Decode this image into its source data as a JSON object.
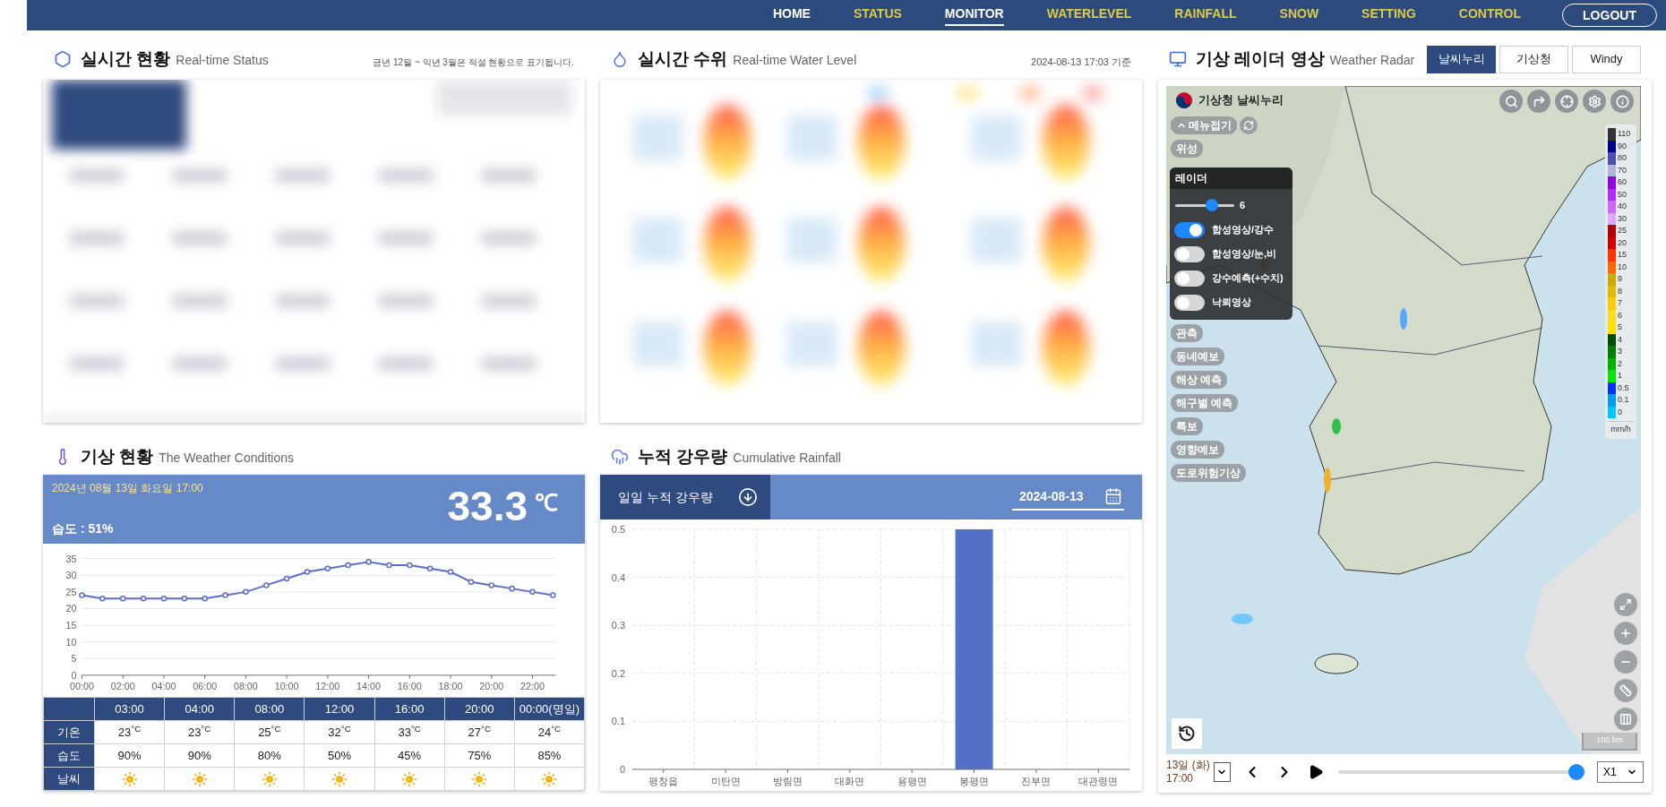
{
  "nav": {
    "items": [
      {
        "label": "HOME",
        "color": "#ffffff",
        "selected": false
      },
      {
        "label": "STATUS",
        "color": "#dccb4c",
        "selected": false
      },
      {
        "label": "MONITOR",
        "color": "#ffffff",
        "selected": true
      },
      {
        "label": "WATERLEVEL",
        "color": "#dccb4c",
        "selected": false
      },
      {
        "label": "RAINFALL",
        "color": "#dccb4c",
        "selected": false
      },
      {
        "label": "SNOW",
        "color": "#dccb4c",
        "selected": false
      },
      {
        "label": "SETTING",
        "color": "#dccb4c",
        "selected": false
      },
      {
        "label": "CONTROL",
        "color": "#dccb4c",
        "selected": false
      }
    ],
    "logout": "LOGOUT"
  },
  "status_panel": {
    "title": "실시간 현황",
    "subtitle": "Real-time Status",
    "note": "금년 12월 ~ 익년 3월은 적설 현황으로 표기됩니다."
  },
  "water_panel": {
    "title": "실시간 수위",
    "subtitle": "Real-time Water Level",
    "timestamp": "2024-08-13 17:03 기준"
  },
  "radar_panel": {
    "title": "기상 레이더 영상",
    "subtitle": "Weather Radar",
    "tabs": [
      {
        "label": "날씨누리",
        "selected": true
      },
      {
        "label": "기상청",
        "selected": false
      },
      {
        "label": "Windy",
        "selected": false
      }
    ],
    "map": {
      "logo": "기상청 날씨누리",
      "collapse_button": "메뉴접기",
      "menu_top": [
        "위성"
      ],
      "layer_panel": {
        "title": "레이더",
        "opacity": {
          "level": 0.65,
          "reading": "6"
        },
        "layers": [
          {
            "label": "합성영상/강수",
            "on": true
          },
          {
            "label": "합성영상/눈,비",
            "on": false
          },
          {
            "label": "강수예측(+수치)",
            "on": false
          },
          {
            "label": "낙뢰영상",
            "on": false
          }
        ]
      },
      "menu_bottom": [
        "관측",
        "동네예보",
        "해상 예측",
        "해구별 예측",
        "특보",
        "영향예보",
        "도로위험기상"
      ],
      "legend": {
        "items": [
          {
            "label": "110",
            "color": "#333333"
          },
          {
            "label": "90",
            "color": "#000090"
          },
          {
            "label": "80",
            "color": "#4c4eb1"
          },
          {
            "label": "70",
            "color": "#b3b4de"
          },
          {
            "label": "60",
            "color": "#9300e4"
          },
          {
            "label": "50",
            "color": "#b329ff"
          },
          {
            "label": "40",
            "color": "#c969ff"
          },
          {
            "label": "30",
            "color": "#e0a9ff"
          },
          {
            "label": "25",
            "color": "#b40000"
          },
          {
            "label": "20",
            "color": "#d20000"
          },
          {
            "label": "15",
            "color": "#ff3200"
          },
          {
            "label": "10",
            "color": "#ff6600"
          },
          {
            "label": "9",
            "color": "#ccaa00"
          },
          {
            "label": "8",
            "color": "#e0b900"
          },
          {
            "label": "7",
            "color": "#f9cd00"
          },
          {
            "label": "6",
            "color": "#ffdc1f"
          },
          {
            "label": "5",
            "color": "#ffe100"
          },
          {
            "label": "4",
            "color": "#004d00"
          },
          {
            "label": "3",
            "color": "#008000"
          },
          {
            "label": "2",
            "color": "#00b300"
          },
          {
            "label": "1",
            "color": "#00e600"
          },
          {
            "label": "0.5",
            "color": "#0033ff"
          },
          {
            "label": "0.1",
            "color": "#009bf5"
          },
          {
            "label": "0",
            "color": "#00c8ff"
          }
        ],
        "unit": "mm/h"
      },
      "scale": "100 km"
    },
    "playback": {
      "day": "13일 (화)",
      "time": "17:00",
      "progress": {
        "level": 1
      },
      "speed": "X1"
    }
  },
  "weather_panel": {
    "title": "기상 현황",
    "subtitle": "The Weather Conditions",
    "datetime": "2024년 08월 13일 화요일 17:00",
    "humidity": "습도 : 51%",
    "temperature": "33.3",
    "unit": "℃",
    "chart_data": {
      "type": "line",
      "x": [
        0,
        1,
        2,
        3,
        4,
        5,
        6,
        7,
        8,
        9,
        10,
        11,
        12,
        13,
        14,
        15,
        16,
        17,
        18,
        19,
        20,
        21,
        22,
        23
      ],
      "grid": true,
      "series": [
        {
          "color": "#5b6fc9",
          "marker": true,
          "values": [
            24,
            23,
            23,
            23,
            23,
            23,
            23,
            24,
            25,
            27,
            29,
            31,
            32,
            33,
            34,
            33,
            33,
            32,
            31,
            28,
            27,
            26,
            25,
            24
          ]
        }
      ],
      "xlim": [
        0,
        23
      ],
      "ylim": [
        0,
        35
      ],
      "xticks": [
        {
          "value": 0,
          "label": "00:00"
        },
        {
          "value": 2,
          "label": "02:00"
        },
        {
          "value": 4,
          "label": "04:00"
        },
        {
          "value": 6,
          "label": "06:00"
        },
        {
          "value": 8,
          "label": "08:00"
        },
        {
          "value": 10,
          "label": "10:00"
        },
        {
          "value": 12,
          "label": "12:00"
        },
        {
          "value": 14,
          "label": "14:00"
        },
        {
          "value": 16,
          "label": "16:00"
        },
        {
          "value": 18,
          "label": "18:00"
        },
        {
          "value": 20,
          "label": "20:00"
        },
        {
          "value": 22,
          "label": "22:00"
        }
      ],
      "yticks": [
        0,
        5,
        10,
        15,
        20,
        25,
        30,
        35
      ]
    },
    "forecast": {
      "row_labels": [
        "기온",
        "습도",
        "날씨"
      ],
      "columns": [
        {
          "time": "03:00",
          "temperature": "23$^{°C}$",
          "humidity": "90%",
          "kind": "sunny"
        },
        {
          "time": "04:00",
          "temperature": "23$^{°C}$",
          "humidity": "90%",
          "kind": "sunny"
        },
        {
          "time": "08:00",
          "temperature": "25$^{°C}$",
          "humidity": "80%",
          "kind": "sunny"
        },
        {
          "time": "12:00",
          "temperature": "32$^{°C}$",
          "humidity": "50%",
          "kind": "sunny"
        },
        {
          "time": "16:00",
          "temperature": "33$^{°C}$",
          "humidity": "45%",
          "kind": "sunny"
        },
        {
          "time": "20:00",
          "temperature": "27$^{°C}$",
          "humidity": "75%",
          "kind": "sunny"
        },
        {
          "time": "00:00(명일)",
          "temperature": "24$^{°C}$",
          "humidity": "85%",
          "kind": "sunny"
        }
      ]
    }
  },
  "rainfall_panel": {
    "title": "누적 강우량",
    "subtitle": "Cumulative Rainfall",
    "tab": "일일 누적 강우량",
    "date": "2024-08-13",
    "chart_data": {
      "type": "bar",
      "categories": [
        "평창읍",
        "미탄면",
        "방림면",
        "대화면",
        "용평면",
        "봉평면",
        "진부면",
        "대관령면"
      ],
      "grid": true,
      "series": [
        {
          "color": "#5470c6",
          "values": [
            0,
            0,
            0,
            0,
            0,
            0.5,
            0,
            0
          ]
        }
      ],
      "ylim": [
        0,
        0.5
      ],
      "yticks": [
        0,
        0.1,
        0.2,
        0.3,
        0.4,
        0.5
      ]
    }
  }
}
